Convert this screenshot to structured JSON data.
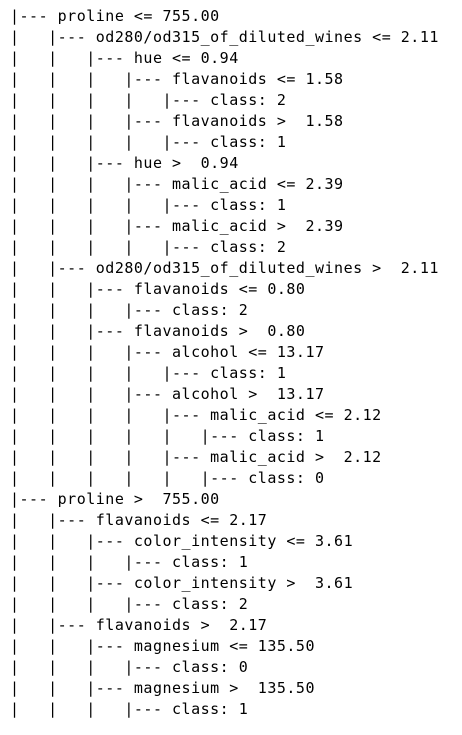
{
  "tree_lines": [
    "|--- proline <= 755.00",
    "|   |--- od280/od315_of_diluted_wines <= 2.11",
    "|   |   |--- hue <= 0.94",
    "|   |   |   |--- flavanoids <= 1.58",
    "|   |   |   |   |--- class: 2",
    "|   |   |   |--- flavanoids >  1.58",
    "|   |   |   |   |--- class: 1",
    "|   |   |--- hue >  0.94",
    "|   |   |   |--- malic_acid <= 2.39",
    "|   |   |   |   |--- class: 1",
    "|   |   |   |--- malic_acid >  2.39",
    "|   |   |   |   |--- class: 2",
    "|   |--- od280/od315_of_diluted_wines >  2.11",
    "|   |   |--- flavanoids <= 0.80",
    "|   |   |   |--- class: 2",
    "|   |   |--- flavanoids >  0.80",
    "|   |   |   |--- alcohol <= 13.17",
    "|   |   |   |   |--- class: 1",
    "|   |   |   |--- alcohol >  13.17",
    "|   |   |   |   |--- malic_acid <= 2.12",
    "|   |   |   |   |   |--- class: 1",
    "|   |   |   |   |--- malic_acid >  2.12",
    "|   |   |   |   |   |--- class: 0",
    "|--- proline >  755.00",
    "|   |--- flavanoids <= 2.17",
    "|   |   |--- color_intensity <= 3.61",
    "|   |   |   |--- class: 1",
    "|   |   |--- color_intensity >  3.61",
    "|   |   |   |--- class: 2",
    "|   |--- flavanoids >  2.17",
    "|   |   |--- magnesium <= 135.50",
    "|   |   |   |--- class: 0",
    "|   |   |--- magnesium >  135.50",
    "|   |   |   |--- class: 1"
  ]
}
